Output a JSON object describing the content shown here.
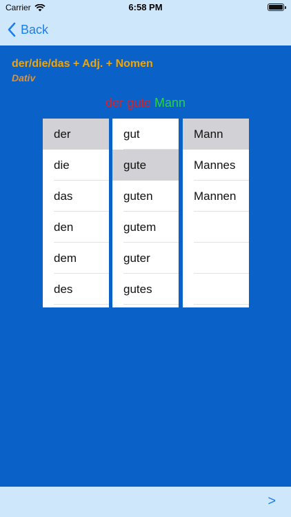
{
  "status_bar": {
    "carrier": "Carrier",
    "time": "6:58 PM"
  },
  "nav": {
    "back_label": "Back",
    "next_label": ">"
  },
  "heading": "der/die/das + Adj. + Nomen",
  "case_label": "Dativ",
  "phrase": {
    "article": "der",
    "adjective": "gute",
    "noun": "Mann"
  },
  "columns": {
    "articles": [
      "der",
      "die",
      "das",
      "den",
      "dem",
      "des"
    ],
    "adjectives": [
      "gut",
      "gute",
      "guten",
      "gutem",
      "guter",
      "gutes"
    ],
    "nouns": [
      "Mann",
      "Mannes",
      "Mannen",
      "",
      "",
      ""
    ]
  },
  "selected": {
    "articles": 0,
    "adjectives": 1,
    "nouns": 0
  },
  "colors": {
    "background": "#0a62c8",
    "bar": "#cfe7fb",
    "accent": "#1a7ef0",
    "heading": "#f2a400",
    "case_label": "#e8912a",
    "phrase_red": "#e02020",
    "phrase_green": "#28d24a",
    "selected_row": "#d1d1d6"
  }
}
